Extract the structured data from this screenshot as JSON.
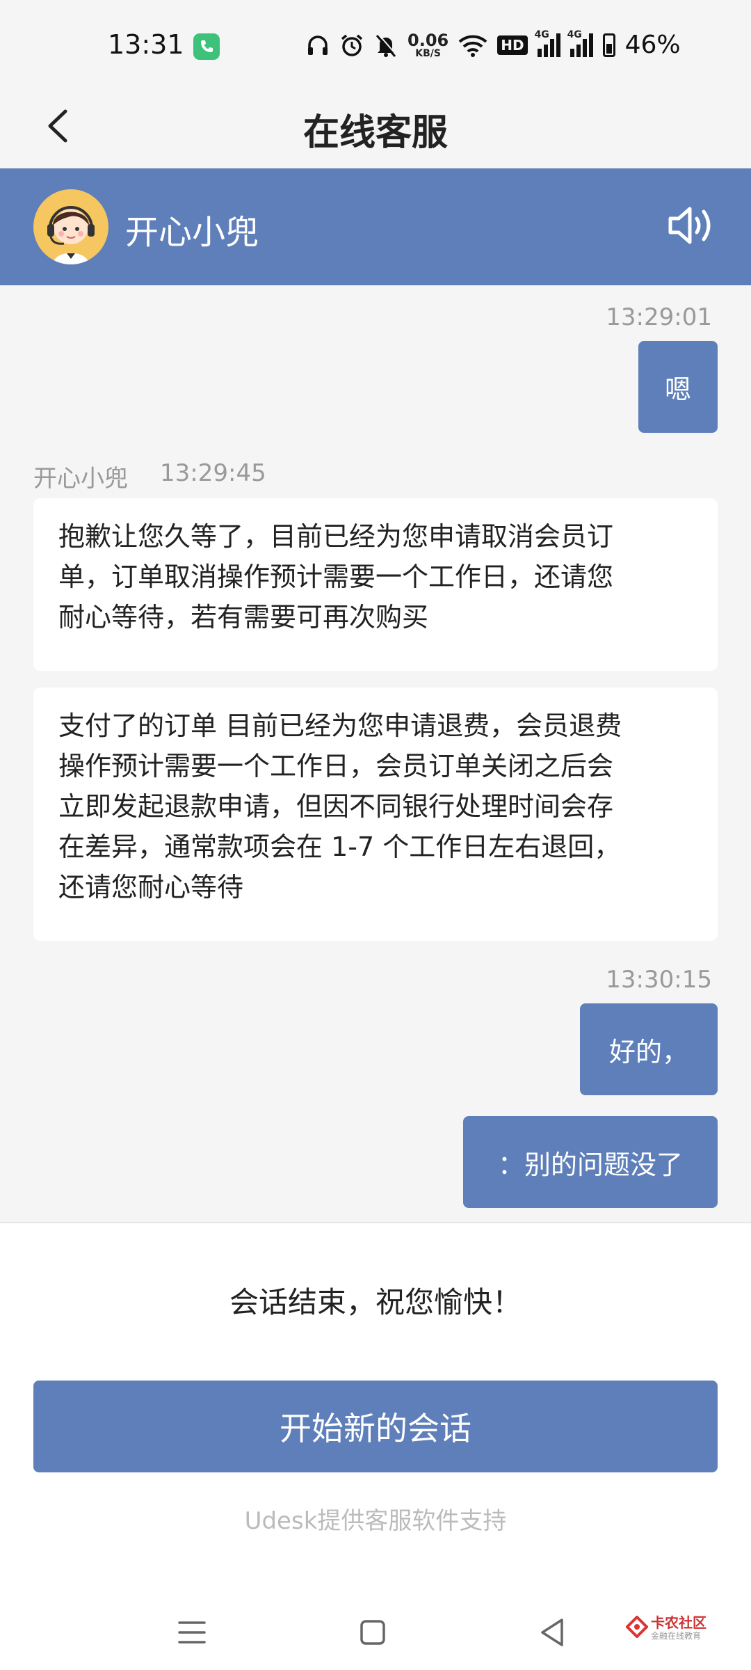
{
  "status_bar": {
    "time": "13:31",
    "net_speed_value": "0.06",
    "net_speed_unit": "KB/S",
    "hd_label": "HD",
    "signal1_label": "4G",
    "signal2_label": "4G",
    "battery_percent": "46%"
  },
  "header": {
    "title": "在线客服"
  },
  "agent": {
    "name": "开心小兜"
  },
  "messages": {
    "m1": {
      "time": "13:29:01",
      "text": "嗯"
    },
    "m2": {
      "sender": "开心小兜",
      "time": "13:29:45",
      "line1": "抱歉让您久等了，目前已经为您申请取消会员订",
      "line2": "单，订单取消操作预计需要一个工作日，还请您",
      "line3": "耐心等待，若有需要可再次购买"
    },
    "m3": {
      "line1": "支付了的订单 目前已经为您申请退费，会员退费",
      "line2": "操作预计需要一个工作日，会员订单关闭之后会",
      "line3": "立即发起退款申请，但因不同银行处理时间会存",
      "line4": "在差异，通常款项会在 1-7 个工作日左右退回，",
      "line5": "还请您耐心等待"
    },
    "m4": {
      "time": "13:30:15",
      "text": "好的，"
    },
    "m5": {
      "text": "：别的问题没了"
    }
  },
  "footer": {
    "end_text": "会话结束，祝您愉快！",
    "new_chat_button": "开始新的会话",
    "powered_by": "Udesk提供客服软件支持"
  },
  "watermark": {
    "title": "卡农社区",
    "subtitle": "金融在线教育"
  },
  "colors": {
    "accent": "#5e7fb9",
    "background": "#f5f5f5"
  }
}
